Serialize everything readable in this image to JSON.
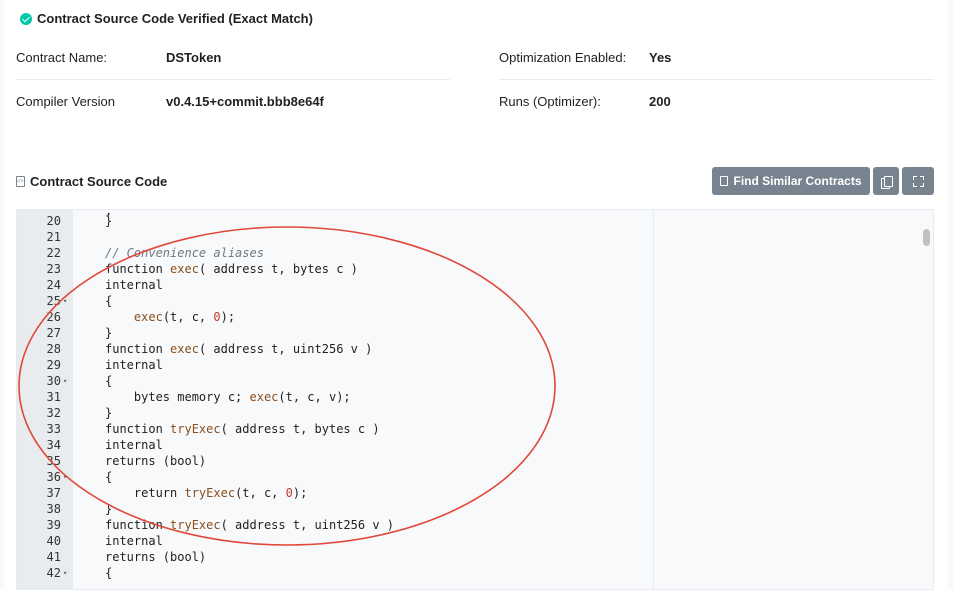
{
  "verified": {
    "label": "Contract Source Code Verified (Exact Match)"
  },
  "details": {
    "contract_name_label": "Contract Name:",
    "contract_name_value": "DSToken",
    "compiler_label": "Compiler Version",
    "compiler_value": "v0.4.15+commit.bbb8e64f",
    "optimization_label": "Optimization Enabled:",
    "optimization_value": "Yes",
    "runs_label": "Runs (Optimizer):",
    "runs_value": "200"
  },
  "source": {
    "title": "Contract Source Code",
    "find_similar_label": "Find Similar Contracts"
  },
  "code_lines": [
    {
      "n": "20",
      "fold": false,
      "text": "}"
    },
    {
      "n": "21",
      "fold": false,
      "text": ""
    },
    {
      "n": "22",
      "fold": false,
      "text": "// Convenience aliases"
    },
    {
      "n": "23",
      "fold": false,
      "text": "function exec( address t, bytes c )"
    },
    {
      "n": "24",
      "fold": false,
      "text": "internal"
    },
    {
      "n": "25",
      "fold": true,
      "text": "{"
    },
    {
      "n": "26",
      "fold": false,
      "text": "    exec(t, c, 0);"
    },
    {
      "n": "27",
      "fold": false,
      "text": "}"
    },
    {
      "n": "28",
      "fold": false,
      "text": "function exec( address t, uint256 v )"
    },
    {
      "n": "29",
      "fold": false,
      "text": "internal"
    },
    {
      "n": "30",
      "fold": true,
      "text": "{"
    },
    {
      "n": "31",
      "fold": false,
      "text": "    bytes memory c; exec(t, c, v);"
    },
    {
      "n": "32",
      "fold": false,
      "text": "}"
    },
    {
      "n": "33",
      "fold": false,
      "text": "function tryExec( address t, bytes c )"
    },
    {
      "n": "34",
      "fold": false,
      "text": "internal"
    },
    {
      "n": "35",
      "fold": false,
      "text": "returns (bool)"
    },
    {
      "n": "36",
      "fold": true,
      "text": "{"
    },
    {
      "n": "37",
      "fold": false,
      "text": "    return tryExec(t, c, 0);"
    },
    {
      "n": "38",
      "fold": false,
      "text": "}"
    },
    {
      "n": "39",
      "fold": false,
      "text": "function tryExec( address t, uint256 v )"
    },
    {
      "n": "40",
      "fold": false,
      "text": "internal"
    },
    {
      "n": "41",
      "fold": false,
      "text": "returns (bool)"
    },
    {
      "n": "42",
      "fold": true,
      "text": "{"
    }
  ],
  "colors": {
    "verified_check": "#00c9a7",
    "button_bg": "#77838f",
    "annotation_ellipse": "#e0483a"
  },
  "icons": {
    "verified": "check-circle-icon",
    "source": "file-code-icon",
    "find": "file-icon",
    "copy": "copy-icon",
    "fullscreen": "expand-icon"
  }
}
